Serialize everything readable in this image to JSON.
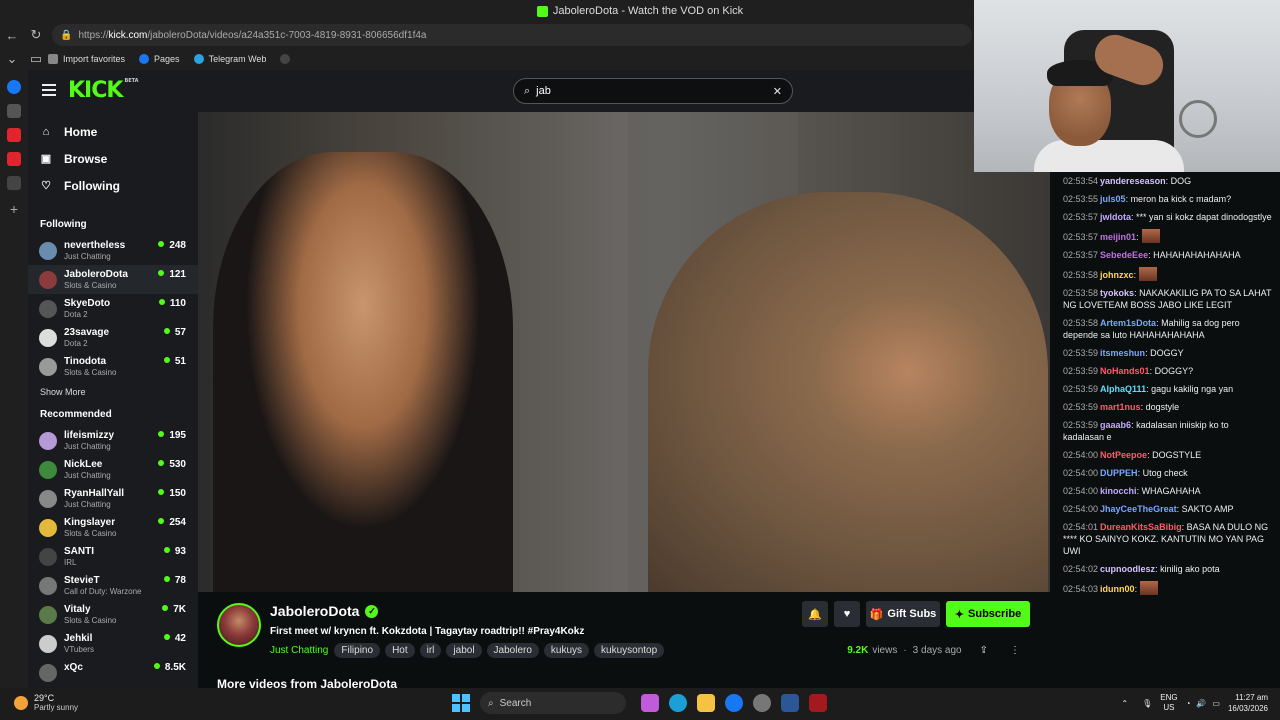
{
  "browser": {
    "tab_title": "JaboleroDota - Watch the VOD on Kick",
    "url_host": "kick.com",
    "url_path": "/jaboleroDota/videos/a24a351c-7003-4819-8931-806656df1f4a",
    "url_scheme": "https://",
    "favorites": [
      "Import favorites",
      "Pages",
      "Telegram Web"
    ]
  },
  "site": {
    "logo": "KICK",
    "logo_badge": "BETA",
    "search_value": "jab",
    "nav": [
      {
        "label": "Home",
        "icon": "home-icon"
      },
      {
        "label": "Browse",
        "icon": "browse-icon"
      },
      {
        "label": "Following",
        "icon": "heart-icon"
      }
    ]
  },
  "sidebar": {
    "following_title": "Following",
    "following": [
      {
        "name": "nevertheless",
        "category": "Just Chatting",
        "viewers": "248",
        "color": "#6a8caf"
      },
      {
        "name": "JaboleroDota",
        "category": "Slots & Casino",
        "viewers": "121",
        "color": "#8b3b3b"
      },
      {
        "name": "SkyeDoto",
        "category": "Dota 2",
        "viewers": "110",
        "color": "#555"
      },
      {
        "name": "23savage",
        "category": "Dota 2",
        "viewers": "57",
        "color": "#ddd"
      },
      {
        "name": "Tinodota",
        "category": "Slots & Casino",
        "viewers": "51",
        "color": "#999"
      }
    ],
    "show_more": "Show More",
    "recommended_title": "Recommended",
    "recommended": [
      {
        "name": "lifeismizzy",
        "category": "Just Chatting",
        "viewers": "195",
        "color": "#b59ad6"
      },
      {
        "name": "NickLee",
        "category": "Just Chatting",
        "viewers": "530",
        "color": "#3c8a3c"
      },
      {
        "name": "RyanHallYall",
        "category": "Just Chatting",
        "viewers": "150",
        "color": "#888"
      },
      {
        "name": "Kingslayer",
        "category": "Slots & Casino",
        "viewers": "254",
        "color": "#e2b93b"
      },
      {
        "name": "SANTI",
        "category": "IRL",
        "viewers": "93",
        "color": "#444"
      },
      {
        "name": "StevieT",
        "category": "Call of Duty: Warzone",
        "viewers": "78",
        "color": "#777"
      },
      {
        "name": "Vitaly",
        "category": "Slots & Casino",
        "viewers": "7K",
        "color": "#5a7a4a"
      },
      {
        "name": "Jehkil",
        "category": "VTubers",
        "viewers": "42",
        "color": "#ccc"
      },
      {
        "name": "xQc",
        "category": "",
        "viewers": "8.5K",
        "color": "#666"
      }
    ]
  },
  "stream": {
    "streamer": "JaboleroDota",
    "title": "First meet w/ kryncn ft. Kokzdota | Tagaytay roadtrip!! #Pray4Kokz",
    "category": "Just Chatting",
    "tags": [
      "Filipino",
      "Hot",
      "irl",
      "jabol",
      "Jabolero",
      "kukuys",
      "kukuysontop"
    ],
    "views": "9.2K",
    "views_label": "views",
    "age": "3 days ago",
    "gift_label": "Gift Subs",
    "subscribe_label": "Subscribe",
    "more_videos": "More videos from JaboleroDota"
  },
  "chat": [
    {
      "time": "02:53:54",
      "user": "yandereseason",
      "color": "#d6c2ff",
      "text": ": DOG"
    },
    {
      "time": "02:53:55",
      "user": "juls05",
      "color": "#7aa7ff",
      "text": ": meron ba kick c madam?"
    },
    {
      "time": "02:53:57",
      "user": "jwldota",
      "color": "#c3a9ff",
      "text": ": *** yan si kokz dapat dinodogstlye"
    },
    {
      "time": "02:53:57",
      "user": "meijin01",
      "color": "#c070e0",
      "text": ":",
      "emote": true
    },
    {
      "time": "02:53:57",
      "user": "SebedeEee",
      "color": "#c070e0",
      "text": ": HAHAHAHAHAHAHA"
    },
    {
      "time": "02:53:58",
      "user": "johnzxc",
      "color": "#ffd84a",
      "text": ":",
      "emote": true
    },
    {
      "time": "02:53:58",
      "user": "tyokoks",
      "color": "#d6c2ff",
      "text": ": NAKAKAKILIG PA TO SA LAHAT NG LOVETEAM BOSS JABO LIKE LEGIT"
    },
    {
      "time": "02:53:58",
      "user": "Artem1sDota",
      "color": "#7aa7ff",
      "text": ": Mahilig sa dog pero depende sa luto HAHAHAHAHAHA"
    },
    {
      "time": "02:53:59",
      "user": "itsmeshun",
      "color": "#7aa7ff",
      "text": ": DOGGY"
    },
    {
      "time": "02:53:59",
      "user": "NoHands01",
      "color": "#ff5b6b",
      "text": ": DOGGY?"
    },
    {
      "time": "02:53:59",
      "user": "AlphaQ111",
      "color": "#5be0ff",
      "text": ": gagu kakilig nga yan"
    },
    {
      "time": "02:53:59",
      "user": "mart1nus",
      "color": "#ff5b6b",
      "text": ": dogstyle"
    },
    {
      "time": "02:53:59",
      "user": "gaaab6",
      "color": "#c3a9ff",
      "text": ": kadalasan iniiskip ko to kadalasan e"
    },
    {
      "time": "02:54:00",
      "user": "NotPeepoe",
      "color": "#ff5b6b",
      "text": ": DOGSTYLE"
    },
    {
      "time": "02:54:00",
      "user": "DUPPEH",
      "color": "#7aa7ff",
      "text": ": Utog check"
    },
    {
      "time": "02:54:00",
      "user": "kinocchi",
      "color": "#c3a9ff",
      "text": ": WHAGAHAHA"
    },
    {
      "time": "02:54:00",
      "user": "JhayCeeTheGreat",
      "color": "#7aa7ff",
      "text": ": SAKTO AMP"
    },
    {
      "time": "02:54:01",
      "user": "DureanKitsSaBibig",
      "color": "#ff5b6b",
      "text": ": BASA NA DULO NG **** KO SAINYO KOKZ. KANTUTIN MO YAN PAG UWI"
    },
    {
      "time": "02:54:02",
      "user": "cupnoodlesz",
      "color": "#d6c2ff",
      "text": ": kinilig ako pota"
    },
    {
      "time": "02:54:03",
      "user": "idunn00",
      "color": "#ffd84a",
      "text": ":",
      "emote": true
    }
  ],
  "taskbar": {
    "temp": "29°C",
    "weather": "Partly sunny",
    "search": "Search",
    "lang1": "ENG",
    "lang2": "US",
    "time": "11:27 am",
    "date": "16/03/2026"
  }
}
